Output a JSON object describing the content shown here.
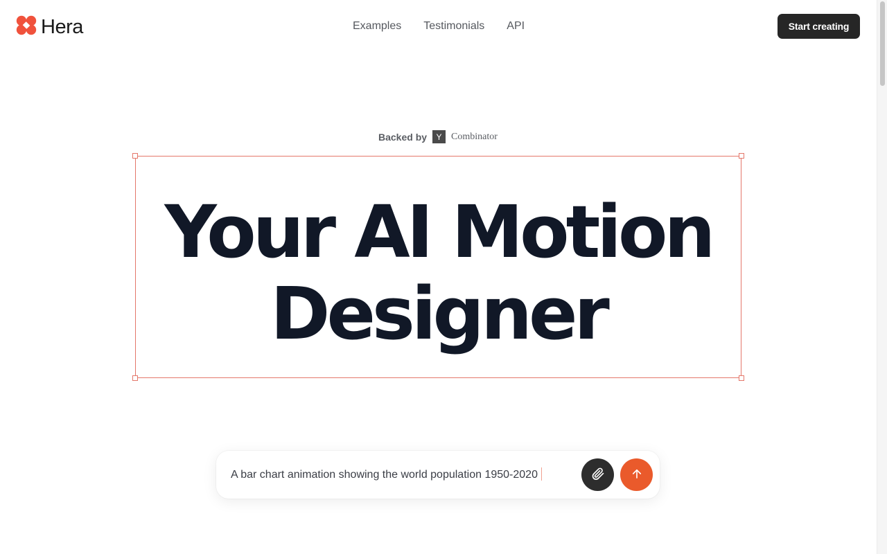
{
  "header": {
    "brand": "Hera",
    "nav": [
      "Examples",
      "Testimonials",
      "API"
    ],
    "cta_label": "Start creating"
  },
  "hero": {
    "backed_label": "Backed by",
    "yc_letter": "Y",
    "yc_name": "Combinator",
    "headline_line1": "Your AI Motion",
    "headline_line2": "Designer"
  },
  "prompt": {
    "value": "A bar chart animation showing the world population 1950-2020"
  },
  "colors": {
    "accent": "#ea5a2b",
    "logo": "#f0523c",
    "selection": "#e4776a"
  },
  "icons": {
    "logo": "hera-logo-icon",
    "attach": "paperclip-icon",
    "send": "arrow-up-icon"
  }
}
